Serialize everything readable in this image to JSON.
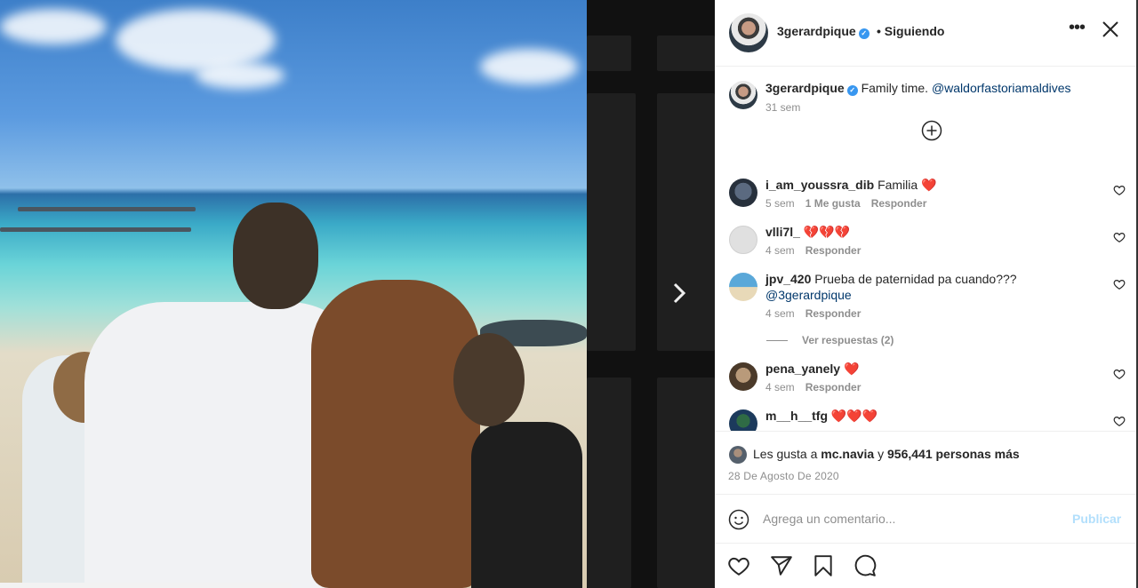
{
  "post": {
    "author": "3gerardpique",
    "follow_status": "• Siguiendo",
    "caption_text": "Family time.",
    "caption_mention": "@waldorfastoriamaldives",
    "caption_time": "31 sem"
  },
  "comments": [
    {
      "user": "i_am_youssra_dib",
      "text": "Familia ❤️",
      "time": "5 sem",
      "likes": "1 Me gusta",
      "reply": "Responder"
    },
    {
      "user": "vlli7l_",
      "text": "💔💔💔",
      "time": "4 sem",
      "reply": "Responder"
    },
    {
      "user": "jpv_420",
      "text": "Prueba de paternidad pa cuando???",
      "mention": "@3gerardpique",
      "time": "4 sem",
      "reply": "Responder"
    },
    {
      "user": "pena_yanely",
      "text": "❤️",
      "time": "4 sem",
      "reply": "Responder"
    },
    {
      "user": "m__h__tfg",
      "text": "❤️❤️❤️"
    }
  ],
  "view_replies": "Ver respuestas (2)",
  "likes": {
    "prefix": "Les gusta a",
    "user": "mc.navia",
    "conj": "y",
    "count": "956,441 personas más"
  },
  "date": "28 De Agosto De 2020",
  "add_comment": {
    "placeholder": "Agrega un comentario...",
    "publish": "Publicar"
  },
  "icons": {
    "more": "more-icon",
    "close": "close-icon",
    "add": "plus-circle-icon",
    "heart": "heart-icon",
    "share": "paper-plane-icon",
    "save": "bookmark-icon",
    "comment": "comment-bubble-icon",
    "emoji": "smiley-icon",
    "next": "chevron-right-icon"
  },
  "colors": {
    "verified": "#3897f0",
    "link": "#00376b",
    "publish_disabled": "#b2dffc"
  }
}
